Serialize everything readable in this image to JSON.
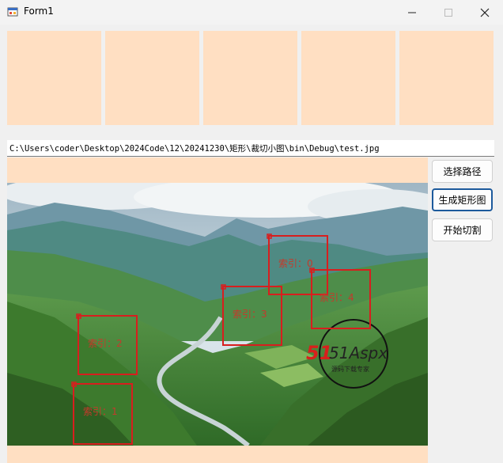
{
  "window": {
    "title": "Form1",
    "minimize_icon": "minimize-icon",
    "maximize_icon": "maximize-icon",
    "close_icon": "close-icon"
  },
  "thumbnails_count_visible": 5,
  "path": {
    "value": "C:\\Users\\coder\\Desktop\\2024Code\\12\\20241230\\矩形\\裁切小图\\bin\\Debug\\test.jpg"
  },
  "buttons": {
    "select_path": "选择路径",
    "generate_rects": "生成矩形图",
    "start_cut": "开始切割"
  },
  "regions": [
    {
      "label": "索引：0"
    },
    {
      "label": "索引：1"
    },
    {
      "label": "索引：2"
    },
    {
      "label": "索引：3"
    },
    {
      "label": "索引：4"
    }
  ],
  "watermark": {
    "logo_text": "51Aspx",
    "sub_text": "源码下载专家"
  },
  "colors": {
    "placeholder_fill": "#ffdfc2",
    "rect_stroke": "#d81e1e",
    "label_color": "#c43a2b"
  }
}
